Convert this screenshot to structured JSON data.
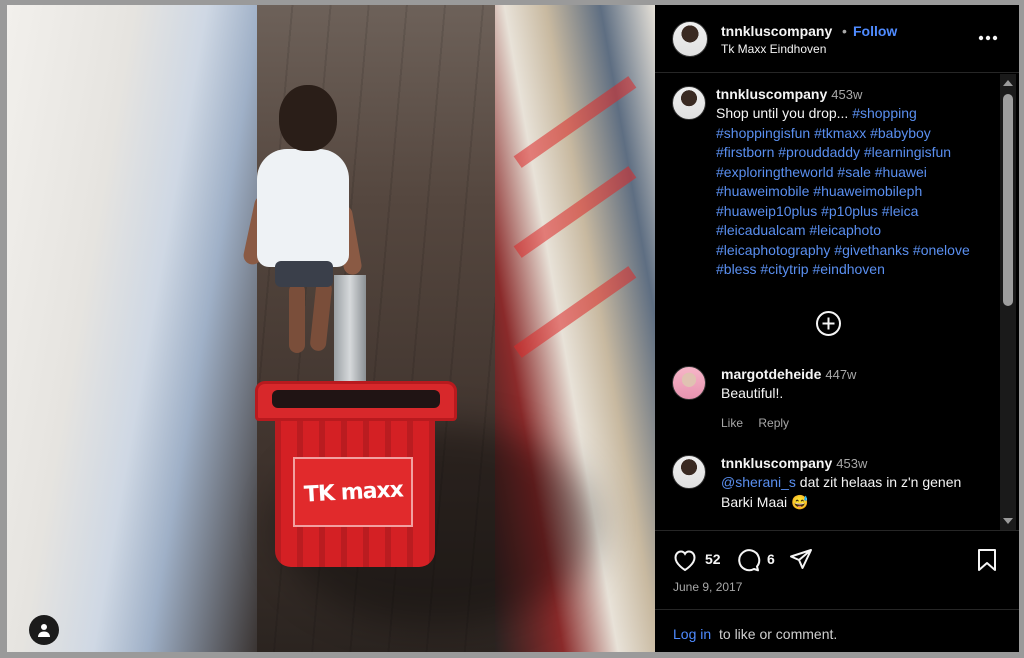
{
  "header": {
    "username": "tnnkluscompany",
    "dot": "•",
    "follow_label": "Follow",
    "location": "Tk Maxx Eindhoven"
  },
  "photo": {
    "basket_label": "TK maxx"
  },
  "caption": {
    "username": "tnnkluscompany",
    "time": "453w",
    "text": "Shop until you drop... ",
    "hashtags": "#shopping #shoppingisfun #tkmaxx #babyboy #firstborn #prouddaddy #learningisfun #exploringtheworld #sale #huawei #huaweimobile #huaweimobileph #huaweip10plus #p10plus #leica #leicadualcam #leicaphoto #leicaphotography #givethanks #onelove #bless #citytrip #eindhoven"
  },
  "comments": [
    {
      "username": "margotdeheide",
      "time": "447w",
      "text": "Beautiful!.",
      "like_label": "Like",
      "reply_label": "Reply"
    },
    {
      "username": "tnnkluscompany",
      "time": "453w",
      "mention": "@sherani_s",
      "text": " dat zit helaas in z'n genen Barki Maai 😅"
    }
  ],
  "actions": {
    "likes": "52",
    "comments": "6",
    "date": "June 9, 2017"
  },
  "login": {
    "link_label": "Log in",
    "rest_text": " to like or comment."
  },
  "colors": {
    "accent_blue": "#4f8bff",
    "hashtag_blue": "#5a8ff0",
    "panel_bg": "#000000",
    "basket_red": "#d42024"
  }
}
